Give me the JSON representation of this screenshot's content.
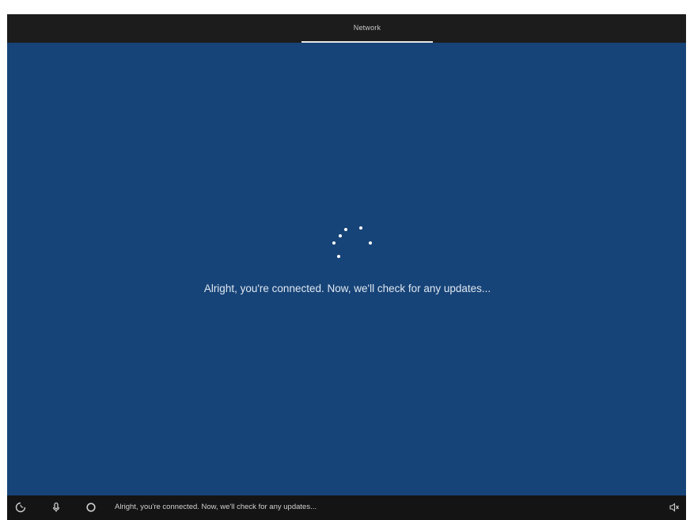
{
  "header": {
    "tab_label": "Network"
  },
  "main": {
    "message": "Alright, you're connected. Now, we'll check for any updates..."
  },
  "taskbar": {
    "status_text": "Alright, you're connected. Now, we'll check for any updates...",
    "icons": [
      "ease-of-access-icon",
      "microphone-icon",
      "cortana-icon",
      "volume-icon"
    ]
  },
  "colors": {
    "accent_blue": "#174478",
    "bar_dark": "#1c1c1c"
  }
}
